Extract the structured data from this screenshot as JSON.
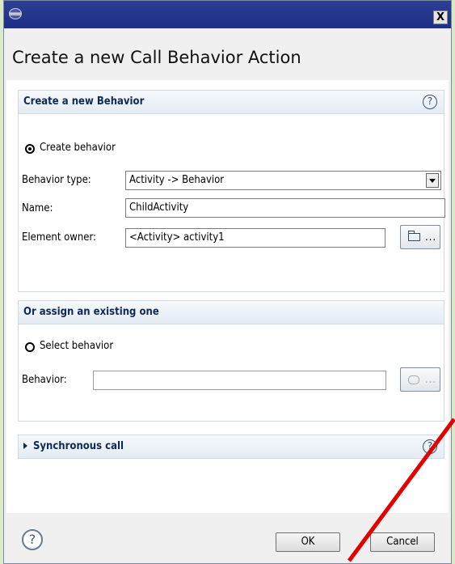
{
  "window": {
    "close_label": "X"
  },
  "dialog": {
    "title": "Create a new Call Behavior Action"
  },
  "create_section": {
    "title": "Create a new Behavior",
    "help": "?",
    "radio_label": "Create behavior",
    "behavior_type_label": "Behavior type:",
    "behavior_type_value": "Activity -> Behavior",
    "name_label": "Name:",
    "name_value": "ChildActivity",
    "owner_label": "Element owner:",
    "owner_value": "<Activity> activity1",
    "browse_label": "..."
  },
  "assign_section": {
    "title": "Or assign an existing one",
    "radio_label": "Select behavior",
    "behavior_label": "Behavior:",
    "behavior_value": "",
    "browse_label": "..."
  },
  "sync_section": {
    "title": "Synchronous call",
    "help": "?"
  },
  "footer": {
    "help": "?",
    "ok_label": "OK",
    "cancel_label": "Cancel"
  },
  "annotation": {
    "arrow_color": "#e00000"
  }
}
